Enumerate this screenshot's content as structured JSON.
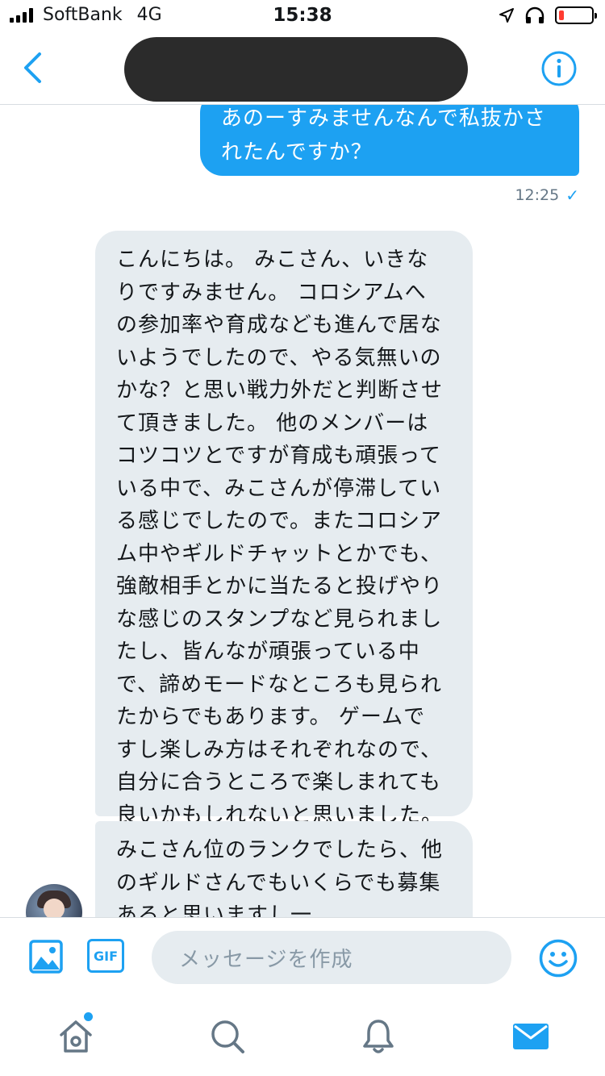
{
  "status_bar": {
    "carrier": "SoftBank",
    "network": "4G",
    "time": "15:38"
  },
  "nav": {
    "back_icon": "chevron-left-icon",
    "info_icon": "info-circle-icon",
    "accent_color": "#1da1f2"
  },
  "messages": {
    "outgoing": {
      "lines": [
        "あのーすみませんなんで私抜かさ",
        "れたんですか？"
      ],
      "time": "12:25",
      "status_icon": "✓"
    },
    "incoming_1": {
      "lines": [
        "こんにちは。 みこさん、いきな",
        "りですみません。 コロシアムへ",
        "の参加率や育成なども進んで居な",
        "いようでしたので、やる気無いの",
        "かな？と思い戦力外だと判断させ",
        "て頂きました。 他のメンバーは",
        "コツコツとですが育成も頑張って",
        "いる中で、みこさんが停滞してい",
        "る感じでしたので。またコロシア",
        "ム中やギルドチャットとかでも、",
        "強敵相手とかに当たると投げやり",
        "な感じのスタンプなど見られまし",
        "たし、皆んなが頑張っている中",
        "で、諦めモードなところも見られ",
        "たからでもあります。 ゲームで",
        "すし楽しみ方はそれぞれなので、",
        "自分に合うところで楽しまれても",
        "良いかもしれないと思いました。"
      ]
    },
    "incoming_2": {
      "lines": [
        "みこさん位のランクでしたら、他",
        "のギルドさんでもいくらでも募集",
        "あると思いますし一"
      ]
    }
  },
  "composer": {
    "placeholder": "メッセージを作成",
    "gif_label": "GIF"
  },
  "tabs": {
    "home": "home-icon",
    "search": "search-icon",
    "notifications": "bell-icon",
    "messages": "mail-icon"
  }
}
